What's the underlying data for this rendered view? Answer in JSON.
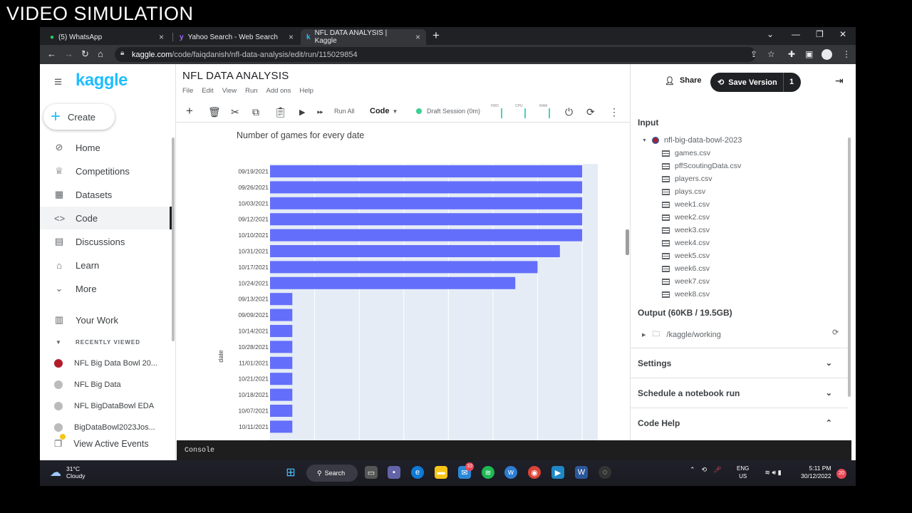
{
  "overlay_text": "VIDEO SIMULATION",
  "browser": {
    "tabs": [
      {
        "label": "(5) WhatsApp",
        "icon": "whatsapp-icon"
      },
      {
        "label": "Yahoo Search - Web Search",
        "icon": "yahoo-icon"
      },
      {
        "label": "NFL DATA ANALYSIS | Kaggle",
        "icon": "kaggle-icon"
      }
    ],
    "url_domain": "kaggle.com",
    "url_path": "/code/faiqdanish/nfl-data-analysis/edit/run/115029854"
  },
  "sidebar": {
    "logo": "kaggle",
    "create_label": "Create",
    "items": [
      {
        "label": "Home",
        "icon": "compass-icon",
        "glyph": "⊘"
      },
      {
        "label": "Competitions",
        "icon": "trophy-icon",
        "glyph": "♕"
      },
      {
        "label": "Datasets",
        "icon": "table-icon",
        "glyph": "▦"
      },
      {
        "label": "Code",
        "icon": "code-icon",
        "glyph": "<>"
      },
      {
        "label": "Discussions",
        "icon": "comment-icon",
        "glyph": "▤"
      },
      {
        "label": "Learn",
        "icon": "school-icon",
        "glyph": "⌂"
      },
      {
        "label": "More",
        "icon": "chevron-down-icon",
        "glyph": "⌄"
      },
      {
        "label": "Your Work",
        "icon": "document-icon",
        "glyph": "▥"
      }
    ],
    "recent_header": "RECENTLY VIEWED",
    "recent": [
      "NFL Big Data Bowl 20...",
      "NFL Big Data",
      "NFL BigDataBowl EDA",
      "BigDataBowl2023Jos..."
    ],
    "events_label": "View Active Events"
  },
  "editor": {
    "title": "NFL DATA ANALYSIS",
    "menu": [
      "File",
      "Edit",
      "View",
      "Run",
      "Add ons",
      "Help"
    ],
    "run_all": "Run All",
    "cell_type": "Code",
    "session": "Draft Session (0m)",
    "meters": [
      "HDD",
      "CPU",
      "RAM"
    ]
  },
  "chart_data": {
    "type": "bar",
    "orientation": "horizontal",
    "title": "Number of games for every date",
    "ylabel": "date",
    "xlabel": "",
    "categories": [
      "09/19/2021",
      "09/26/2021",
      "10/03/2021",
      "09/12/2021",
      "10/10/2021",
      "10/31/2021",
      "10/17/2021",
      "10/24/2021",
      "09/13/2021",
      "09/09/2021",
      "10/14/2021",
      "10/28/2021",
      "11/01/2021",
      "10/21/2021",
      "10/18/2021",
      "10/07/2021",
      "10/11/2021"
    ],
    "values": [
      14,
      14,
      14,
      14,
      14,
      13,
      12,
      11,
      1,
      1,
      1,
      1,
      1,
      1,
      1,
      1,
      1
    ],
    "xlim": [
      0,
      14.7
    ],
    "color": "#636efa",
    "plot_bg": "#e5ecf6"
  },
  "right_panel": {
    "share_label": "Share",
    "save_label": "Save Version",
    "save_count": "1",
    "input_header": "Input",
    "dataset": "nfl-big-data-bowl-2023",
    "files": [
      "games.csv",
      "pffScoutingData.csv",
      "players.csv",
      "plays.csv",
      "week1.csv",
      "week2.csv",
      "week3.csv",
      "week4.csv",
      "week5.csv",
      "week6.csv",
      "week7.csv",
      "week8.csv"
    ],
    "output_header": "Output (60KB / 19.5GB)",
    "output_path": "/kaggle/working",
    "sections": [
      "Settings",
      "Schedule a notebook run",
      "Code Help"
    ]
  },
  "console_label": "Console",
  "taskbar": {
    "temp": "31°C",
    "weather": "Cloudy",
    "search_label": "Search",
    "mail_badge": "10",
    "lang_1": "ENG",
    "lang_2": "US",
    "time": "5:11 PM",
    "date": "30/12/2022",
    "notifications": "20"
  }
}
